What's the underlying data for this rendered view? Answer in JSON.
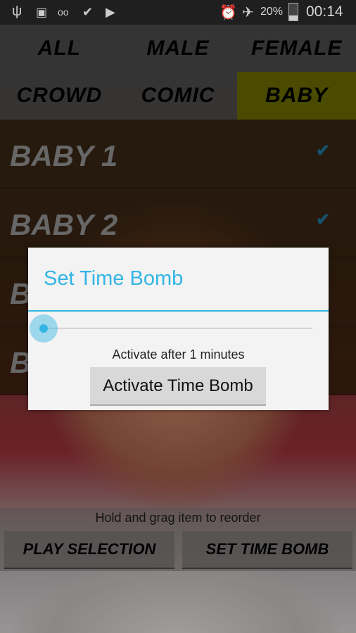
{
  "status_bar": {
    "icons_left": [
      "usb-icon",
      "image-icon",
      "voicemail-icon",
      "briefcase-check-icon",
      "briefcase-play-icon"
    ],
    "icons_right": [
      "alarm-icon",
      "airplane-icon",
      "battery-icon"
    ],
    "battery": "20%",
    "time": "00:14"
  },
  "tabs": [
    {
      "label": "ALL"
    },
    {
      "label": "MALE"
    },
    {
      "label": "FEMALE"
    },
    {
      "label": "CROWD"
    },
    {
      "label": "COMIC"
    },
    {
      "label": "BABY",
      "selected": true
    }
  ],
  "accent": "#33b5e5",
  "selected_tab_color": "#636300",
  "list": [
    {
      "label": "BABY 1",
      "checked": true
    },
    {
      "label": "BABY 2",
      "checked": true
    },
    {
      "label": "B",
      "checked": true
    },
    {
      "label": "B",
      "checked": true
    }
  ],
  "dialog": {
    "title": "Set Time Bomb",
    "slider_value": 1,
    "message": "Activate after 1 minutes",
    "button": "Activate Time Bomb"
  },
  "footer": {
    "hint": "Hold and grag item to reorder",
    "play_button": "PLAY SELECTION",
    "time_bomb_button": "SET TIME BOMB"
  }
}
